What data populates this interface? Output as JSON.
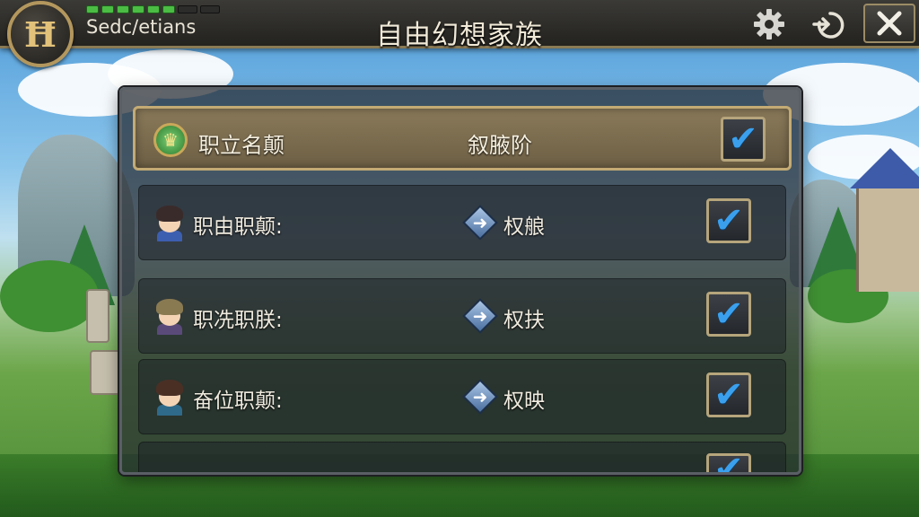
{
  "topbar": {
    "user_name": "Sedc/etians",
    "title": "自由幻想家族",
    "hp_full": 6,
    "hp_total": 8,
    "logo_glyph": "Ħ"
  },
  "icons": {
    "settings": "gear-icon",
    "logout": "exit-icon",
    "close": "close-icon"
  },
  "header_row": {
    "label": "职立名颠",
    "value": "叙腋阶",
    "checked": true
  },
  "rows": [
    {
      "label": "职由职颠:",
      "value": "权艆",
      "checked": true,
      "hair": "#3a2b2b",
      "outfit": "#3d5fb0"
    },
    {
      "label": "职冼职朕:",
      "value": "权扶",
      "checked": true,
      "hair": "#8a7a52",
      "outfit": "#5a4a7a"
    },
    {
      "label": "奋位职颠:",
      "value": "权映",
      "checked": true,
      "hair": "#4a2f25",
      "outfit": "#2f6a8a"
    },
    {
      "label": "",
      "value": "",
      "checked": true
    }
  ],
  "colors": {
    "check": "#3aa0ee",
    "gold_border": "#c4ab74",
    "hp_green": "#4bbd44"
  }
}
